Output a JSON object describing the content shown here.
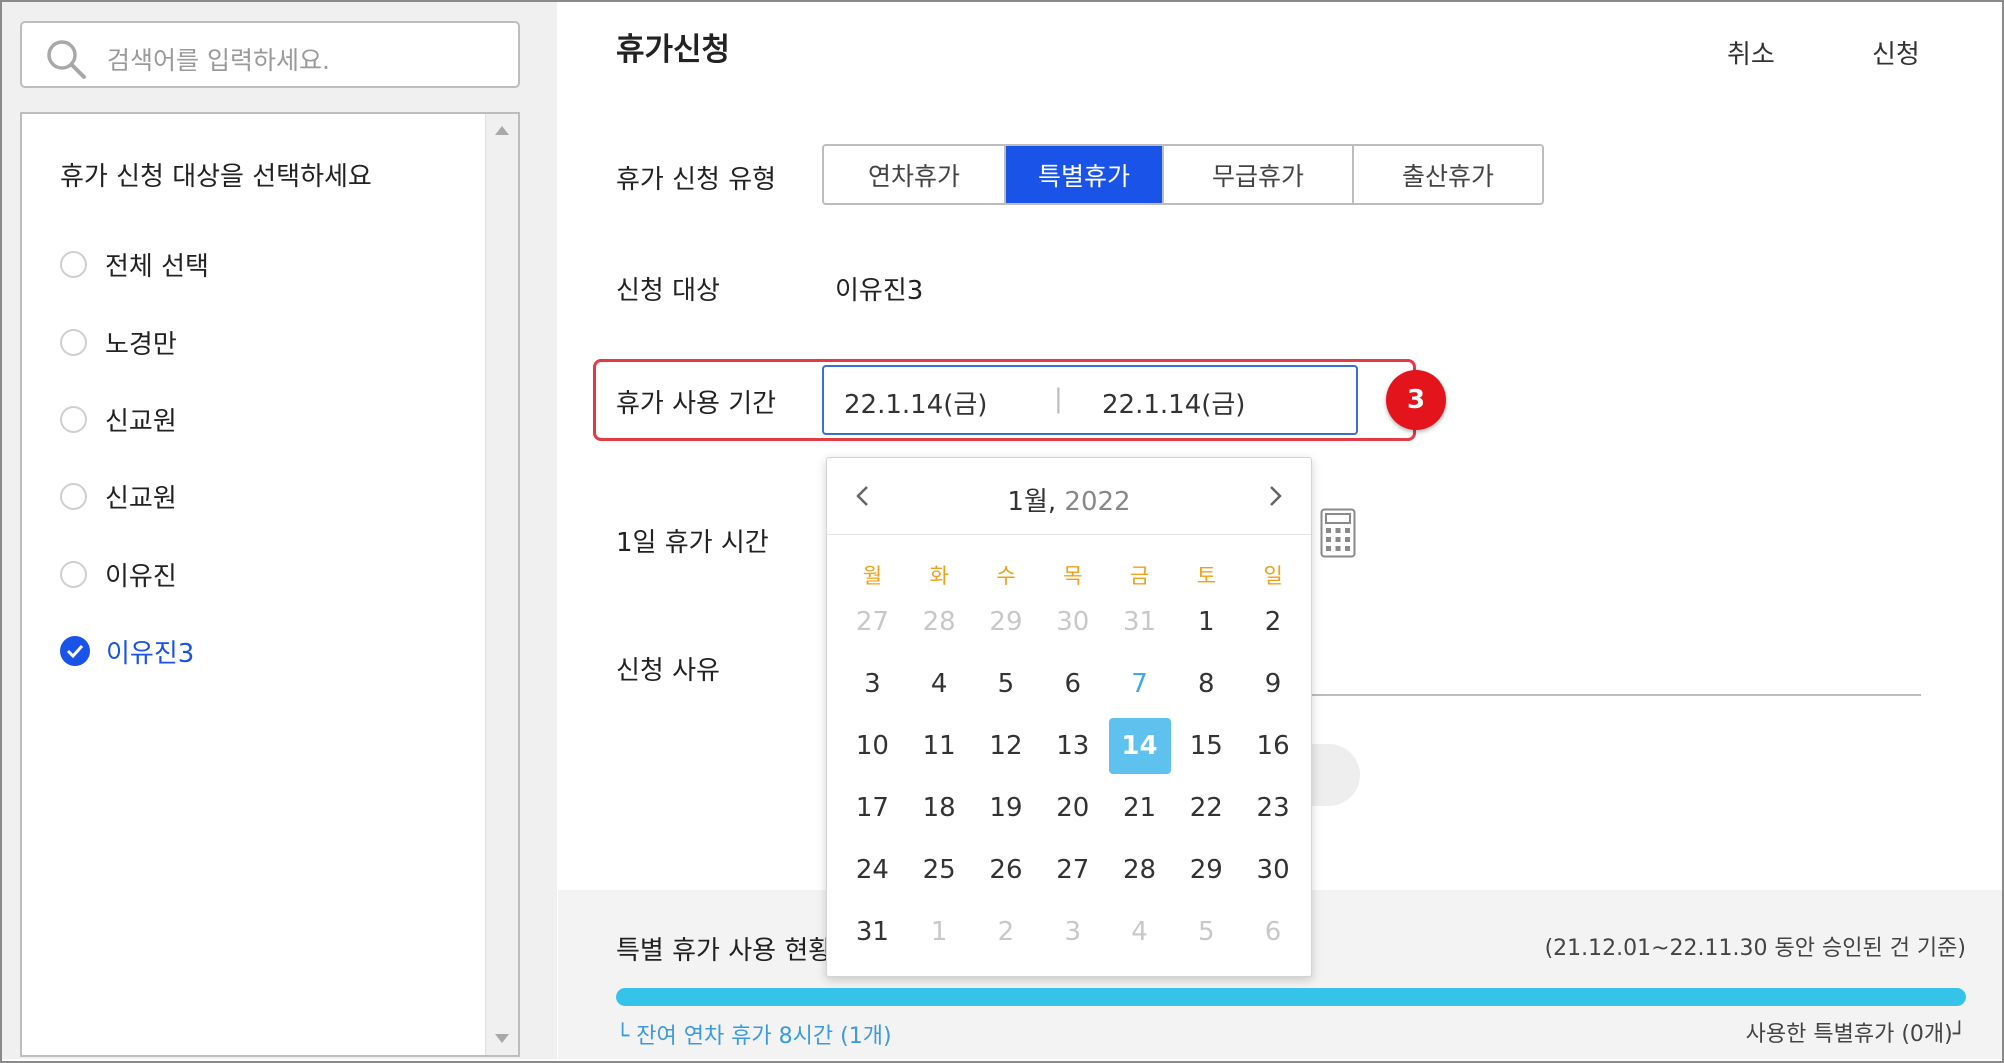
{
  "sidebar": {
    "search_placeholder": "검색어를 입력하세요.",
    "list_title": "휴가 신청 대상을 선택하세요",
    "items": [
      {
        "label": "전체 선택",
        "checked": false
      },
      {
        "label": "노경만",
        "checked": false
      },
      {
        "label": "신교원",
        "checked": false
      },
      {
        "label": "신교원",
        "checked": false
      },
      {
        "label": "이유진",
        "checked": false
      },
      {
        "label": "이유진3",
        "checked": true
      }
    ]
  },
  "header": {
    "title": "휴가신청",
    "cancel_label": "취소",
    "submit_label": "신청"
  },
  "form": {
    "type_label": "휴가 신청 유형",
    "types": [
      "연차휴가",
      "특별휴가",
      "무급휴가",
      "출산휴가"
    ],
    "active_type": "특별휴가",
    "target_label": "신청 대상",
    "target_value": "이유진3",
    "period_label": "휴가 사용 기간",
    "start_date": "22.1.14(금)",
    "end_date": "22.1.14(금)",
    "separator": "|",
    "daily_hours_label": "1일 휴가 시간",
    "reason_label": "신청 사유"
  },
  "step_badge": "3",
  "calendar": {
    "month": "1월,",
    "year": "2022",
    "weekdays": [
      "월",
      "화",
      "수",
      "목",
      "금",
      "토",
      "일"
    ],
    "weeks": [
      [
        "27",
        "28",
        "29",
        "30",
        "31",
        "1",
        "2"
      ],
      [
        "3",
        "4",
        "5",
        "6",
        "7",
        "8",
        "9"
      ],
      [
        "10",
        "11",
        "12",
        "13",
        "14",
        "15",
        "16"
      ],
      [
        "17",
        "18",
        "19",
        "20",
        "21",
        "22",
        "23"
      ],
      [
        "24",
        "25",
        "26",
        "27",
        "28",
        "29",
        "30"
      ],
      [
        "31",
        "1",
        "2",
        "3",
        "4",
        "5",
        "6"
      ]
    ],
    "selected_day": "14",
    "today_day": "7"
  },
  "status": {
    "title": "특별 휴가 사용 현황",
    "period": "(21.12.01~22.11.30 동안 승인된 건 기준)",
    "remaining": "└ 잔여 연차 휴가 8시간 (1개)",
    "used": "사용한 특별휴가 (0개)┘",
    "progress_percent": 100,
    "progress_color": "#36c3ea"
  },
  "colors": {
    "accent": "#1a53e8",
    "highlight": "#e63946",
    "badge": "#e3141b",
    "weekday": "#f0a11a",
    "calendar_selected": "#5fc1ee"
  }
}
